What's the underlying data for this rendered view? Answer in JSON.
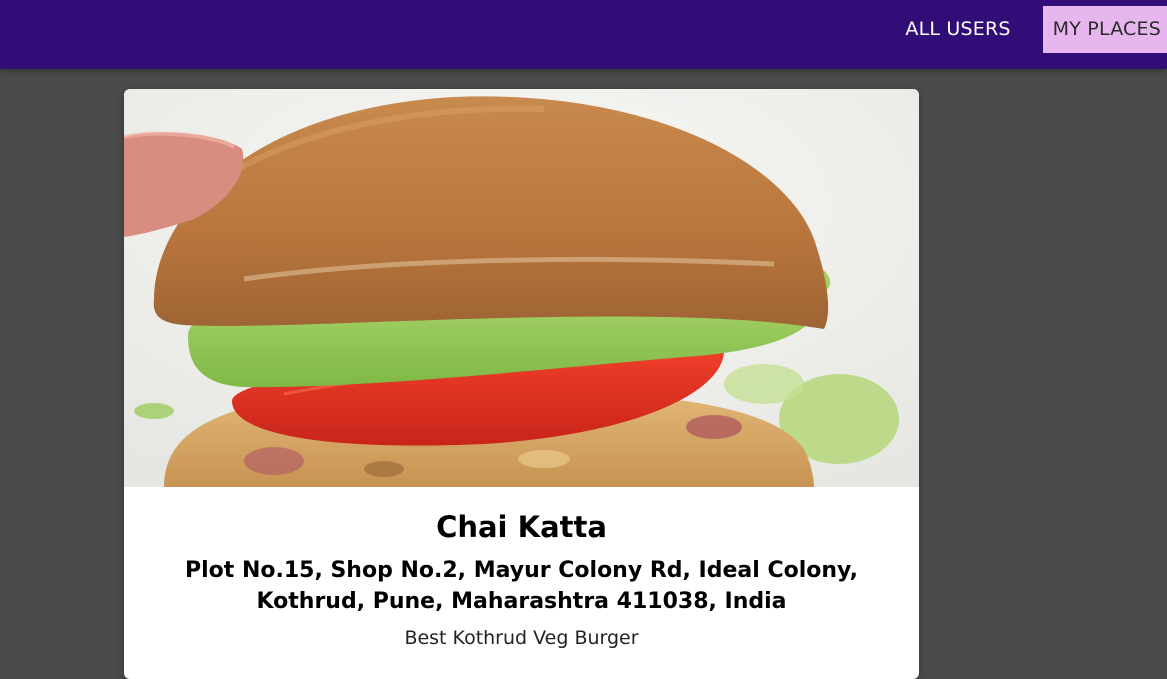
{
  "nav": {
    "links": [
      {
        "label": "ALL USERS",
        "active": false
      },
      {
        "label": "MY PLACES",
        "active": true
      }
    ],
    "colors": {
      "bar": "#310d77",
      "active_bg": "#e7b6ee"
    }
  },
  "place": {
    "image_subject": "veggie burger with avocado and tomato",
    "title": "Chai Katta",
    "address": "Plot No.15, Shop No.2, Mayur Colony Rd, Ideal Colony, Kothrud, Pune, Maharashtra 411038, India",
    "description": "Best Kothrud Veg Burger"
  }
}
